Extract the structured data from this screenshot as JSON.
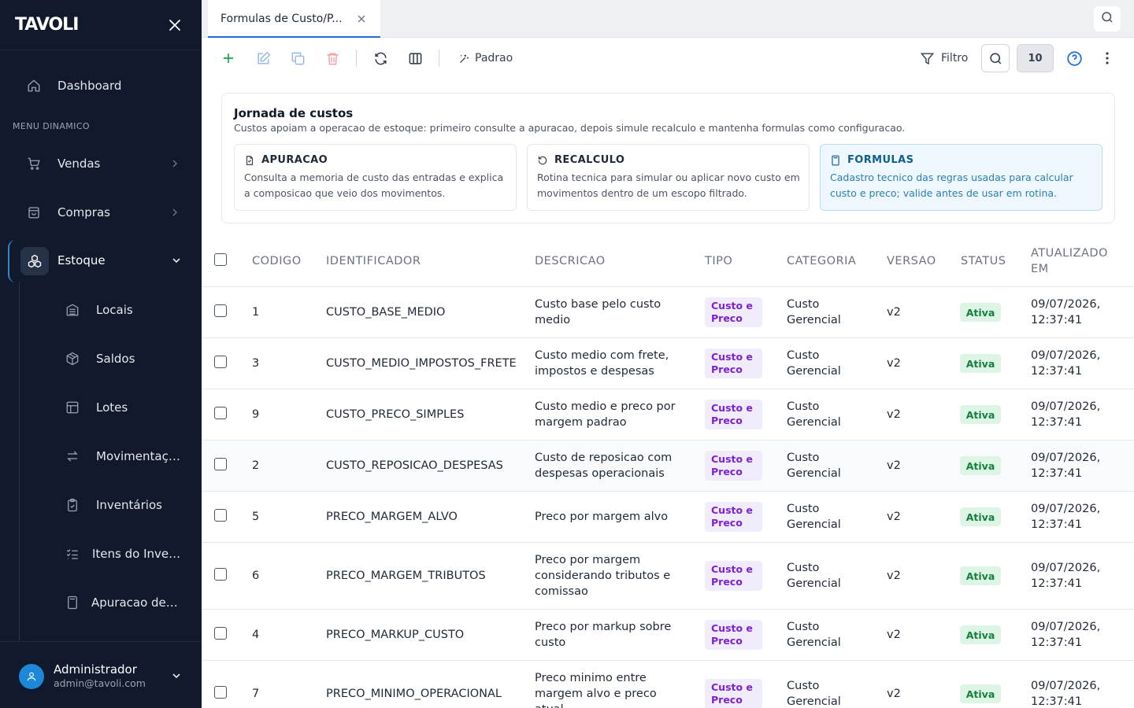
{
  "sidebar": {
    "logo": "TAVOLI",
    "dashboard": "Dashboard",
    "menu_label": "MENU DINAMICO",
    "vendas": "Vendas",
    "compras": "Compras",
    "estoque": "Estoque",
    "sub_items": [
      {
        "label": "Locais",
        "icon": "building-icon"
      },
      {
        "label": "Saldos",
        "icon": "box-icon"
      },
      {
        "label": "Lotes",
        "icon": "layout-icon"
      },
      {
        "label": "Movimentaçõ...",
        "icon": "arrows-icon"
      },
      {
        "label": "Inventários",
        "icon": "clipboard-icon"
      },
      {
        "label": "Itens do Inven...",
        "icon": "list-check-icon"
      },
      {
        "label": "Apuracao de ...",
        "icon": "calculator-icon"
      }
    ],
    "user": {
      "name": "Administrador",
      "email": "admin@tavoli.com"
    }
  },
  "tabs": {
    "active": "Formulas de Custo/P..."
  },
  "toolbar": {
    "padrao": "Padrao",
    "filtro": "Filtro",
    "page_size": "10"
  },
  "journey": {
    "title": "Jornada de custos",
    "description": "Custos apoiam a operacao de estoque: primeiro consulte a apuracao, depois simule recalculo e mantenha formulas como configuracao.",
    "cards": [
      {
        "title": "APURACAO",
        "body": "Consulta a memoria de custo das entradas e explica a composicao que veio dos movimentos."
      },
      {
        "title": "RECALCULO",
        "body": "Rotina tecnica para simular ou aplicar novo custo em movimentos dentro de um escopo filtrado."
      },
      {
        "title": "FORMULAS",
        "body": "Cadastro tecnico das regras usadas para calcular custo e preco; valide antes de usar em rotina."
      }
    ]
  },
  "table": {
    "headers": {
      "codigo": "CODIGO",
      "identificador": "IDENTIFICADOR",
      "descricao": "DESCRICAO",
      "tipo": "TIPO",
      "categoria": "CATEGORIA",
      "versao": "VERSAO",
      "status": "STATUS",
      "atualizado": "ATUALIZADO EM"
    },
    "rows": [
      {
        "codigo": "1",
        "identificador": "CUSTO_BASE_MEDIO",
        "descricao": "Custo base pelo custo medio",
        "tipo": "Custo e Preco",
        "categoria": "Custo Gerencial",
        "versao": "v2",
        "status": "Ativa",
        "atualizado": "09/07/2026, 12:37:41"
      },
      {
        "codigo": "3",
        "identificador": "CUSTO_MEDIO_IMPOSTOS_FRETE",
        "descricao": "Custo medio com frete, impostos e despesas",
        "tipo": "Custo e Preco",
        "categoria": "Custo Gerencial",
        "versao": "v2",
        "status": "Ativa",
        "atualizado": "09/07/2026, 12:37:41"
      },
      {
        "codigo": "9",
        "identificador": "CUSTO_PRECO_SIMPLES",
        "descricao": "Custo medio e preco por margem padrao",
        "tipo": "Custo e Preco",
        "categoria": "Custo Gerencial",
        "versao": "v2",
        "status": "Ativa",
        "atualizado": "09/07/2026, 12:37:41"
      },
      {
        "codigo": "2",
        "identificador": "CUSTO_REPOSICAO_DESPESAS",
        "descricao": "Custo de reposicao com despesas operacionais",
        "tipo": "Custo e Preco",
        "categoria": "Custo Gerencial",
        "versao": "v2",
        "status": "Ativa",
        "atualizado": "09/07/2026, 12:37:41"
      },
      {
        "codigo": "5",
        "identificador": "PRECO_MARGEM_ALVO",
        "descricao": "Preco por margem alvo",
        "tipo": "Custo e Preco",
        "categoria": "Custo Gerencial",
        "versao": "v2",
        "status": "Ativa",
        "atualizado": "09/07/2026, 12:37:41"
      },
      {
        "codigo": "6",
        "identificador": "PRECO_MARGEM_TRIBUTOS",
        "descricao": "Preco por margem considerando tributos e comissao",
        "tipo": "Custo e Preco",
        "categoria": "Custo Gerencial",
        "versao": "v2",
        "status": "Ativa",
        "atualizado": "09/07/2026, 12:37:41"
      },
      {
        "codigo": "4",
        "identificador": "PRECO_MARKUP_CUSTO",
        "descricao": "Preco por markup sobre custo",
        "tipo": "Custo e Preco",
        "categoria": "Custo Gerencial",
        "versao": "v2",
        "status": "Ativa",
        "atualizado": "09/07/2026, 12:37:41"
      },
      {
        "codigo": "7",
        "identificador": "PRECO_MINIMO_OPERACIONAL",
        "descricao": "Preco minimo entre margem alvo e preco atual",
        "tipo": "Custo e Preco",
        "categoria": "Custo Gerencial",
        "versao": "v2",
        "status": "Ativa",
        "atualizado": "09/07/2026, 12:37:41"
      }
    ]
  }
}
